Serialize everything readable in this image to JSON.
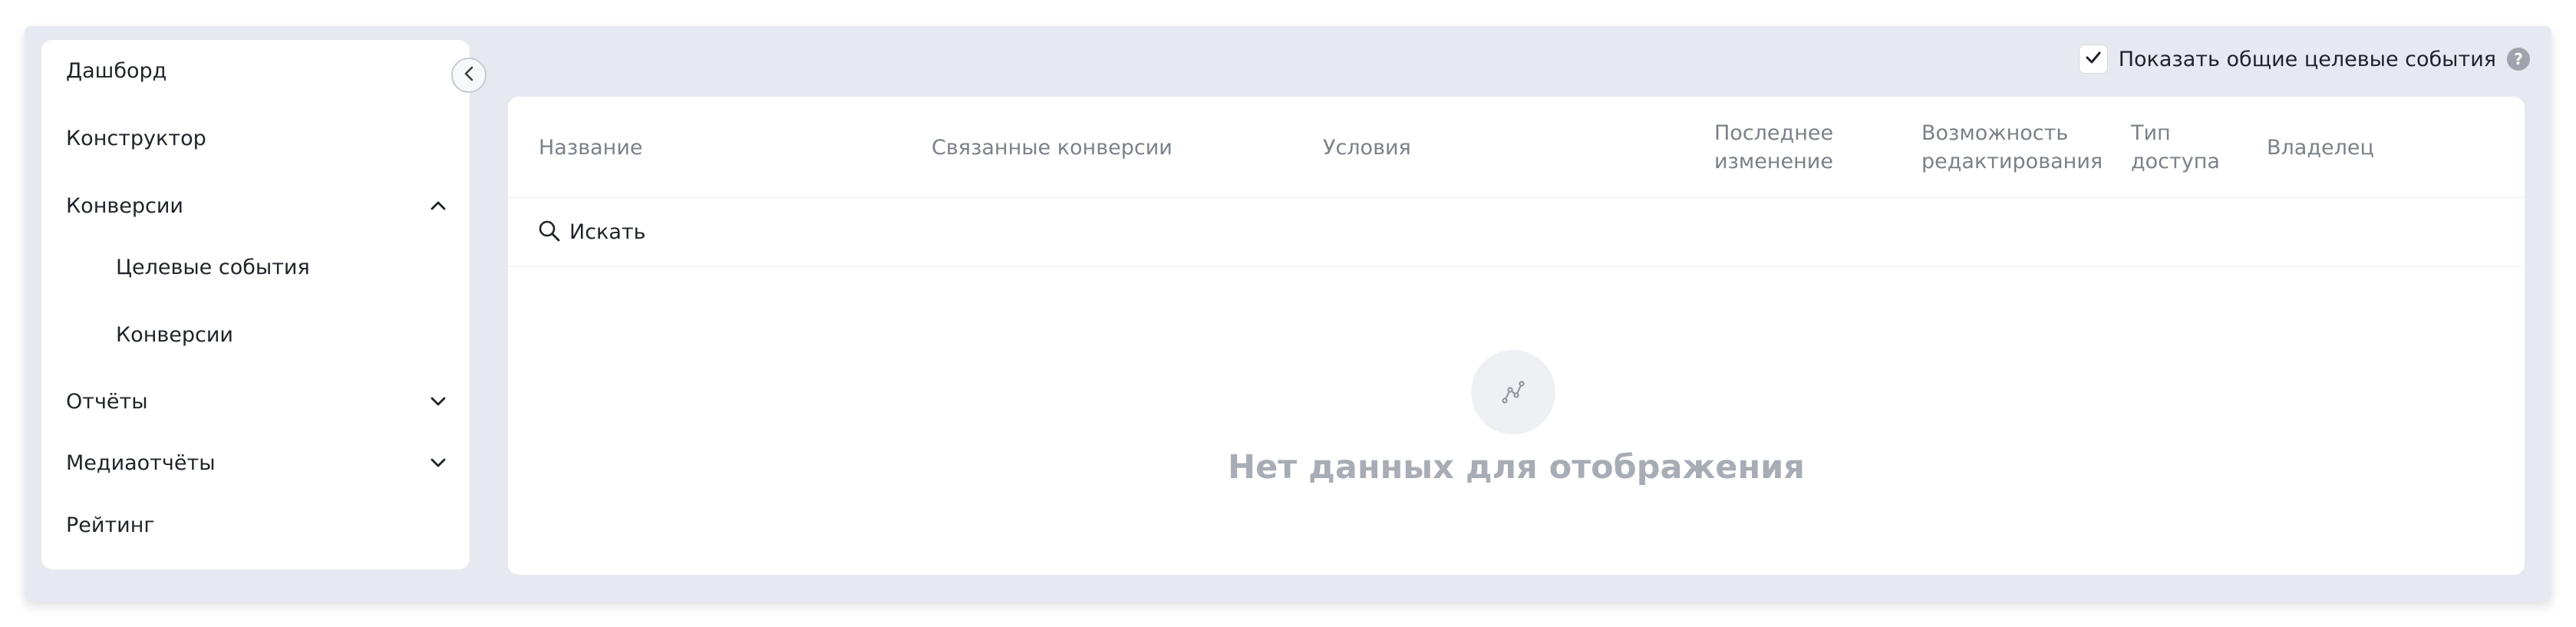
{
  "sidebar": {
    "items": [
      {
        "label": "Дашборд"
      },
      {
        "label": "Конструктор"
      },
      {
        "label": "Конверсии",
        "expanded": true,
        "chevron_icon": "chevron-up-icon",
        "children": [
          {
            "label": "Целевые события"
          },
          {
            "label": "Конверсии"
          }
        ]
      },
      {
        "label": "Отчёты",
        "expanded": false,
        "chevron_icon": "chevron-down-icon"
      },
      {
        "label": "Медиаотчёты",
        "expanded": false,
        "chevron_icon": "chevron-down-icon"
      },
      {
        "label": "Рейтинг"
      }
    ],
    "collapse_icon": "chevron-left-icon"
  },
  "toolbar": {
    "show_common_label": "Показать общие целевые события",
    "show_common_checked": true,
    "help_glyph": "?"
  },
  "table": {
    "columns": [
      {
        "line1": "Название",
        "line2": ""
      },
      {
        "line1": "Связанные конверсии",
        "line2": ""
      },
      {
        "line1": "Условия",
        "line2": ""
      },
      {
        "line1": "Последнее",
        "line2": "изменение"
      },
      {
        "line1": "Возможность",
        "line2": "редактирования"
      },
      {
        "line1": "Тип",
        "line2": "доступа"
      },
      {
        "line1": "Владелец",
        "line2": ""
      }
    ],
    "search_label": "Искать",
    "empty_text": "Нет данных для отображения",
    "empty_icon": "chart-line-icon"
  }
}
